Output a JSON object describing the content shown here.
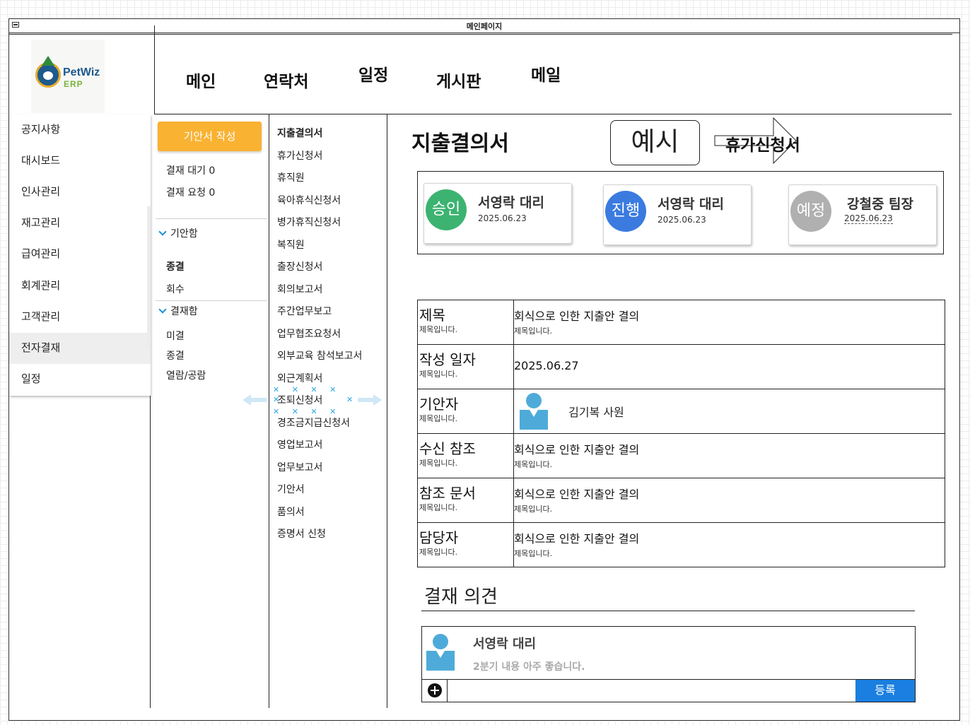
{
  "window": {
    "title": "메인페이지"
  },
  "logo": {
    "name": "PetWiz",
    "sub": "ERP"
  },
  "top_nav": [
    "메인",
    "연락처",
    "일정",
    "게시판",
    "메일"
  ],
  "sidebar": {
    "items": [
      "공지사항",
      "대시보드",
      "인사관리",
      "재고관리",
      "급여관리",
      "회계관리",
      "고객관리",
      "전자결재",
      "일정"
    ],
    "active": "전자결재"
  },
  "approval_menu": {
    "draft_button": "기안서 작성",
    "pending": "결재 대기 0",
    "requested": "결재 요청 0",
    "draft_box": "기안함",
    "closed_heading": "종결",
    "withdraw": "회수",
    "approval_box": "결재함",
    "unclosed": "미결",
    "closed": "종결",
    "viewed": "열람/공람"
  },
  "doc_types": [
    "지출결의서",
    "휴가신청서",
    "휴직원",
    "육아휴식신청서",
    "병가휴직신청서",
    "복직원",
    "출장신청서",
    "회의보고서",
    "주간업무보고",
    "업무협조요청서",
    "외부교육 참석보고서",
    "외근계획서",
    "조퇴신청서",
    "경조금지급신청서",
    "영업보고서",
    "업무보고서",
    "기안서",
    "품의서",
    "증명서 신청"
  ],
  "main": {
    "doc_title": "지출결의서",
    "example_button": "예시",
    "next_doc": "휴가신청서"
  },
  "approvers": [
    {
      "status": "승인",
      "name": "서영락 대리",
      "date": "2025.06.23",
      "color": "#3cb371"
    },
    {
      "status": "진행",
      "name": "서영락 대리",
      "date": "2025.06.23",
      "color": "#3b7be0"
    },
    {
      "status": "예정",
      "name": "강철중 팀장",
      "date": "2025.06.23",
      "color": "#b0b0b0"
    }
  ],
  "info": {
    "title": {
      "label": "제목",
      "hint": "제목입니다.",
      "value": "회식으로 인한 지출안 결의",
      "value_hint": "제목입니다."
    },
    "date": {
      "label": "작성 일자",
      "hint": "제목입니다.",
      "value": "2025.06.27"
    },
    "drafter": {
      "label": "기안자",
      "hint": "제목입니다.",
      "value": "김기복 사원"
    },
    "recipient": {
      "label": "수신 참조",
      "hint": "제목입니다.",
      "value": "회식으로 인한 지출안 결의",
      "value_hint": "제목입니다."
    },
    "reference": {
      "label": "참조 문서",
      "hint": "제목입니다.",
      "value": "회식으로 인한 지출안 결의",
      "value_hint": "제목입니다."
    },
    "manager": {
      "label": "담당자",
      "hint": "제목입니다.",
      "value": "회식으로 인한 지출안 결의",
      "value_hint": "제목입니다."
    }
  },
  "opinion": {
    "heading": "결재 의견",
    "author": "서영락 대리",
    "text": "2분기 내용 아주 좋습니다.",
    "input_value": "",
    "submit": "등록"
  }
}
